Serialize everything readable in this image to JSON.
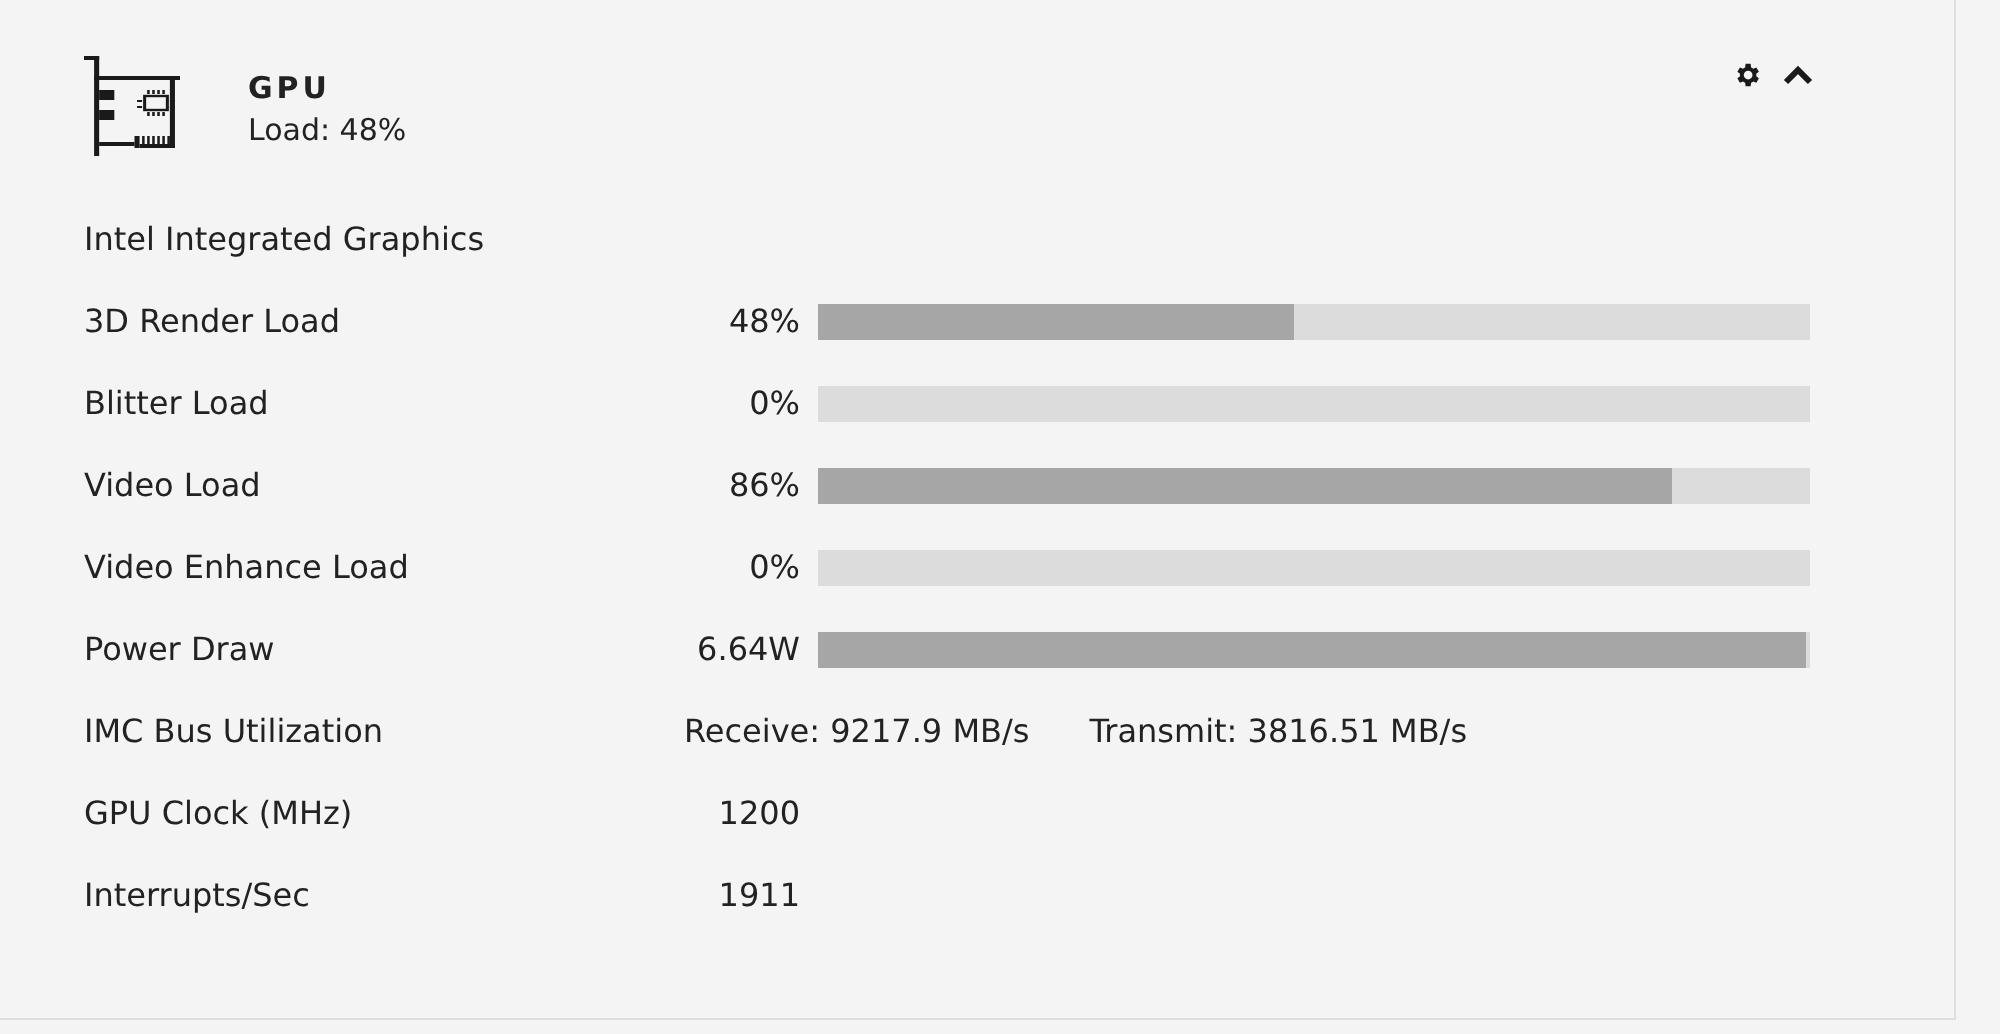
{
  "card": {
    "title": "GPU",
    "subtitle": "Load: 48%",
    "expanded": true
  },
  "device": "Intel Integrated Graphics",
  "rows": [
    {
      "kind": "bar",
      "label": "3D Render Load",
      "value": "48%",
      "level": 0.48
    },
    {
      "kind": "bar",
      "label": "Blitter Load",
      "value": "0%",
      "level": 0
    },
    {
      "kind": "bar",
      "label": "Video Load",
      "value": "86%",
      "level": 0.86
    },
    {
      "kind": "bar",
      "label": "Video Enhance Load",
      "value": "0%",
      "level": 0
    },
    {
      "kind": "bar",
      "label": "Power Draw",
      "value": "6.64W",
      "level": 0.995
    },
    {
      "kind": "pair",
      "label": "IMC Bus Utilization",
      "values": [
        "Receive: 9217.9 MB/s",
        "Transmit: 3816.51 MB/s"
      ]
    },
    {
      "kind": "value",
      "label": "GPU Clock (MHz)",
      "value": "1200"
    },
    {
      "kind": "value",
      "label": "Interrupts/Sec",
      "value": "1911"
    }
  ]
}
